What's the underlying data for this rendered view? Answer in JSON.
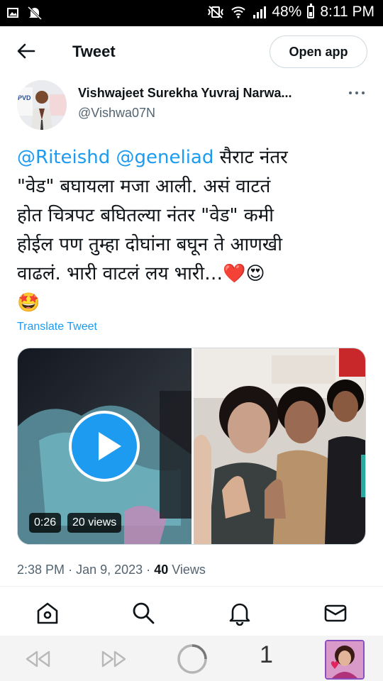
{
  "status_bar": {
    "battery": "48%",
    "time": "8:11 PM"
  },
  "header": {
    "title": "Tweet",
    "open_app_label": "Open app"
  },
  "author": {
    "name": "Vishwajeet Surekha Yuvraj Narwa...",
    "handle": "@Vishwa07N",
    "avatar_sign_text": "PVD"
  },
  "tweet": {
    "mention_1": "@Riteishd",
    "mention_2": "@geneliad",
    "line_1_rest": " सैराट नंतर",
    "line_2": "\"वेड\" बघायला मजा आली. असं वाटतं",
    "line_3": "होत चित्रपट बघितल्या नंतर \"वेड\" कमी",
    "line_4": "होईल पण तुम्हा दोघांना बघून ते आणखी",
    "line_5": "वाढलं. भारी वाटलं लय भारी…",
    "emoji_1": "❤️",
    "emoji_2": "😍",
    "emoji_3": "🤩",
    "translate_label": "Translate Tweet"
  },
  "media": {
    "video_duration": "0:26",
    "video_views": "20 views"
  },
  "meta": {
    "time": "2:38 PM",
    "separator": "·",
    "date": "Jan 9, 2023",
    "views_count": "40",
    "views_label": "Views"
  },
  "browser": {
    "tab_count": "1"
  },
  "colors": {
    "accent": "#1d9bf0",
    "text": "#0f1419",
    "secondary": "#536471",
    "border": "#cfd9de"
  },
  "icons": {
    "back": "arrow-left-icon",
    "more": "more-horizontal-icon",
    "play": "play-icon",
    "home": "home-icon",
    "search": "search-icon",
    "notifications": "bell-icon",
    "messages": "envelope-icon",
    "browser_back": "rewind-icon",
    "browser_forward": "fast-forward-icon",
    "reload": "loading-ring-icon"
  }
}
